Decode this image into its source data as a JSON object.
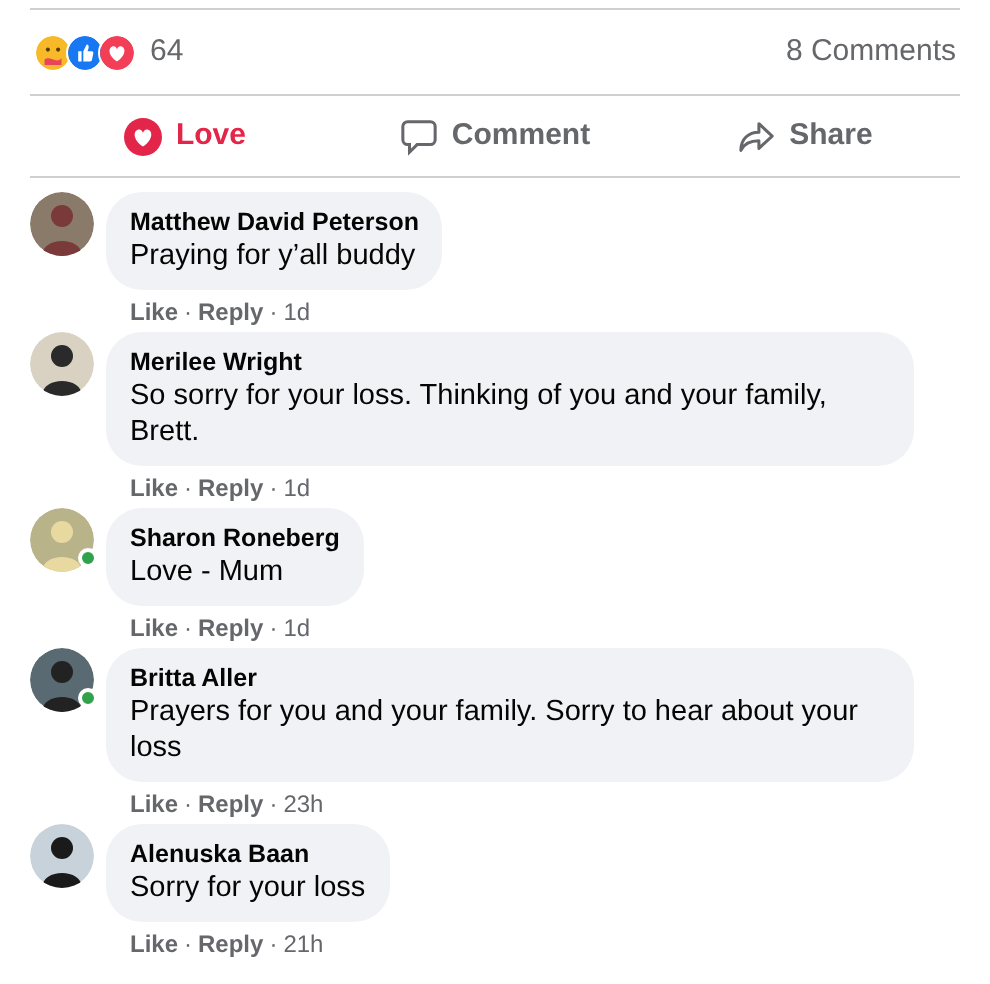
{
  "summary": {
    "reactions": [
      {
        "kind": "care"
      },
      {
        "kind": "like"
      },
      {
        "kind": "love"
      }
    ],
    "count": "64",
    "comments_count": "8 Comments"
  },
  "actions": [
    {
      "kind": "love",
      "label": "Love",
      "selected": true
    },
    {
      "kind": "comment",
      "label": "Comment",
      "selected": false
    },
    {
      "kind": "share",
      "label": "Share",
      "selected": false
    }
  ],
  "comments": [
    {
      "name": "Matthew David Peterson",
      "text": "Praying for y’all buddy",
      "online": false,
      "footer": [
        {
          "kind": "link",
          "text": "Like"
        },
        {
          "kind": "sep",
          "text": "·"
        },
        {
          "kind": "link",
          "text": "Reply"
        },
        {
          "kind": "sep",
          "text": "·"
        },
        {
          "kind": "time",
          "text": "1d"
        }
      ]
    },
    {
      "name": "Merilee Wright",
      "text": "So sorry for your loss. Thinking of you and your family, Brett.",
      "online": false,
      "footer": [
        {
          "kind": "link",
          "text": "Like"
        },
        {
          "kind": "sep",
          "text": "·"
        },
        {
          "kind": "link",
          "text": "Reply"
        },
        {
          "kind": "sep",
          "text": "·"
        },
        {
          "kind": "time",
          "text": "1d"
        }
      ]
    },
    {
      "name": "Sharon Roneberg",
      "text": "Love - Mum",
      "online": true,
      "footer": [
        {
          "kind": "link",
          "text": "Like"
        },
        {
          "kind": "sep",
          "text": "·"
        },
        {
          "kind": "link",
          "text": "Reply"
        },
        {
          "kind": "sep",
          "text": "·"
        },
        {
          "kind": "time",
          "text": "1d"
        }
      ]
    },
    {
      "name": "Britta Aller",
      "text": "Prayers for you and your family. Sorry to hear about your loss",
      "online": true,
      "footer": [
        {
          "kind": "link",
          "text": "Like"
        },
        {
          "kind": "sep",
          "text": "·"
        },
        {
          "kind": "link",
          "text": "Reply"
        },
        {
          "kind": "sep",
          "text": "·"
        },
        {
          "kind": "time",
          "text": "23h"
        }
      ]
    },
    {
      "name": "Alenuska Baan",
      "text": "Sorry for your loss",
      "online": false,
      "footer": [
        {
          "kind": "link",
          "text": "Like"
        },
        {
          "kind": "sep",
          "text": "·"
        },
        {
          "kind": "link",
          "text": "Reply"
        },
        {
          "kind": "sep",
          "text": "·"
        },
        {
          "kind": "time",
          "text": "21h"
        }
      ]
    }
  ]
}
